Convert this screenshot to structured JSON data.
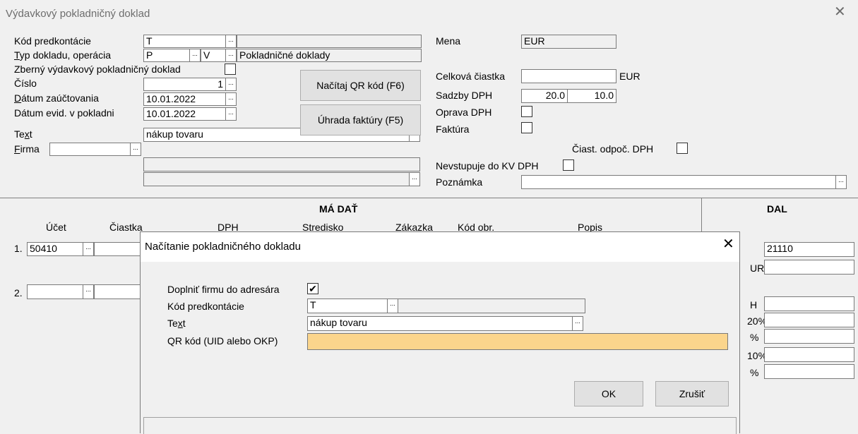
{
  "window": {
    "title": "Výdavkový pokladničný doklad"
  },
  "form": {
    "kod_predkontacie": {
      "label": "Kód predkontácie",
      "value": "T"
    },
    "typ_dokladu": {
      "label_u": "T",
      "label_rest": "yp dokladu, operácia",
      "value1": "P",
      "value2": "V",
      "desc": "Pokladničné doklady"
    },
    "zberny": {
      "label": "Zberný výdavkový pokladničný doklad"
    },
    "cislo": {
      "label": "Číslo",
      "value": "1"
    },
    "datum_zauct": {
      "label_u": "D",
      "label_rest": "átum zaúčtovania",
      "value": "10.01.2022"
    },
    "datum_evid": {
      "label": "Dátum evid. v pokladni",
      "value": "10.01.2022"
    },
    "text": {
      "label_a": "Te",
      "label_u": "x",
      "label_b": "t",
      "value": "nákup tovaru"
    },
    "firma": {
      "label_u": "F",
      "label_rest": "irma"
    },
    "btn_qr": "Načítaj QR kód (F6)",
    "btn_uhrada": "Úhrada faktúry (F5)",
    "mena": {
      "label": "Mena",
      "value": "EUR"
    },
    "celkova": {
      "label": "Celková čiastka",
      "currency": "EUR"
    },
    "sadzby": {
      "label": "Sadzby DPH",
      "v1": "20.0",
      "v2": "10.0"
    },
    "oprava": {
      "label": "Oprava DPH"
    },
    "faktura": {
      "label": "Faktúra"
    },
    "ciast_odpoc": {
      "label": "Čiast. odpoč. DPH"
    },
    "nevstupuje": {
      "label": "Nevstupuje do KV DPH"
    },
    "poznamka": {
      "label": "Poznámka"
    }
  },
  "grid": {
    "ma_dat": "MÁ DAŤ",
    "dal": "DAL",
    "columns": [
      "Účet",
      "Čiastka",
      "DPH",
      "Stredisko",
      "Zákazka",
      "Kód obr.",
      "Popis"
    ],
    "row1": {
      "num": "1.",
      "ucet": "50410"
    },
    "row2": {
      "num": "2."
    },
    "dal_ucet": "21110",
    "dal_partial": [
      "UR",
      "H",
      "20%",
      "%",
      "10%",
      "%"
    ]
  },
  "dialog": {
    "title": "Načítanie pokladničného dokladu",
    "doplnit": {
      "label": "Doplniť firmu do adresára"
    },
    "kod": {
      "label": "Kód predkontácie",
      "value": "T"
    },
    "text": {
      "label_a": "Te",
      "label_u": "x",
      "label_b": "t",
      "value": "nákup tovaru"
    },
    "qr": {
      "label": "QR kód (UID alebo OKP)",
      "value": ""
    },
    "ok": "OK",
    "cancel": "Zrušiť"
  },
  "colors": {
    "qr_field": "#fbd58c",
    "title_text": "#6d6d6d"
  }
}
